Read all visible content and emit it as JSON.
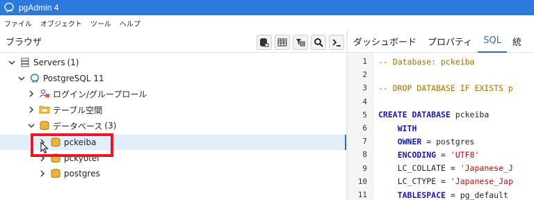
{
  "window": {
    "title": "pgAdmin 4"
  },
  "menubar": {
    "items": [
      "ファイル",
      "オブジェクト",
      "ツール",
      "ヘルプ"
    ]
  },
  "browser": {
    "title": "ブラウザ",
    "toolbar": [
      "database-icon",
      "table-grid-icon",
      "filter-table-icon",
      "search-icon",
      "terminal-icon"
    ]
  },
  "tree": {
    "servers": {
      "label": "Servers",
      "count": "(1)"
    },
    "server": {
      "label": "PostgreSQL 11"
    },
    "login_roles": {
      "label": "ログイン/グループロール"
    },
    "tablespaces": {
      "label": "テーブル空間"
    },
    "databases": {
      "label": "データベース",
      "count": "(3)"
    },
    "db_items": [
      "pckeiba",
      "pckyotei",
      "postgres"
    ]
  },
  "tabs": [
    "ダッシュボード",
    "プロパティ",
    "SQL",
    "統"
  ],
  "active_tab": "SQL",
  "editor": {
    "lines": [
      {
        "n": "1",
        "tokens": [
          {
            "t": "-- Database: pckeiba",
            "c": "cm"
          }
        ]
      },
      {
        "n": "2",
        "tokens": []
      },
      {
        "n": "3",
        "tokens": [
          {
            "t": "-- DROP DATABASE IF EXISTS p",
            "c": "cm"
          }
        ]
      },
      {
        "n": "4",
        "tokens": []
      },
      {
        "n": "5",
        "tokens": [
          {
            "t": "CREATE DATABASE",
            "c": "kw"
          },
          {
            "t": " pckeiba",
            "c": "plain"
          }
        ]
      },
      {
        "n": "6",
        "tokens": [
          {
            "t": "    WITH",
            "c": "kw"
          }
        ]
      },
      {
        "n": "7",
        "tokens": [
          {
            "t": "    OWNER",
            "c": "kw"
          },
          {
            "t": " = postgres",
            "c": "plain"
          }
        ]
      },
      {
        "n": "8",
        "tokens": [
          {
            "t": "    ENCODING",
            "c": "kw"
          },
          {
            "t": " = ",
            "c": "plain"
          },
          {
            "t": "'UTF8'",
            "c": "str"
          }
        ]
      },
      {
        "n": "9",
        "tokens": [
          {
            "t": "    LC_COLLATE = ",
            "c": "plain"
          },
          {
            "t": "'Japanese_J",
            "c": "str"
          }
        ]
      },
      {
        "n": "10",
        "tokens": [
          {
            "t": "    LC_CTYPE = ",
            "c": "plain"
          },
          {
            "t": "'Japanese_Jap",
            "c": "str"
          }
        ]
      },
      {
        "n": "11",
        "tokens": [
          {
            "t": "    TABLESPACE",
            "c": "kw"
          },
          {
            "t": " = pg_default",
            "c": "plain"
          }
        ]
      }
    ]
  },
  "colors": {
    "titlebar": "#2a7bdd",
    "accent": "#2f6fb5",
    "highlight": "#e8182a"
  }
}
